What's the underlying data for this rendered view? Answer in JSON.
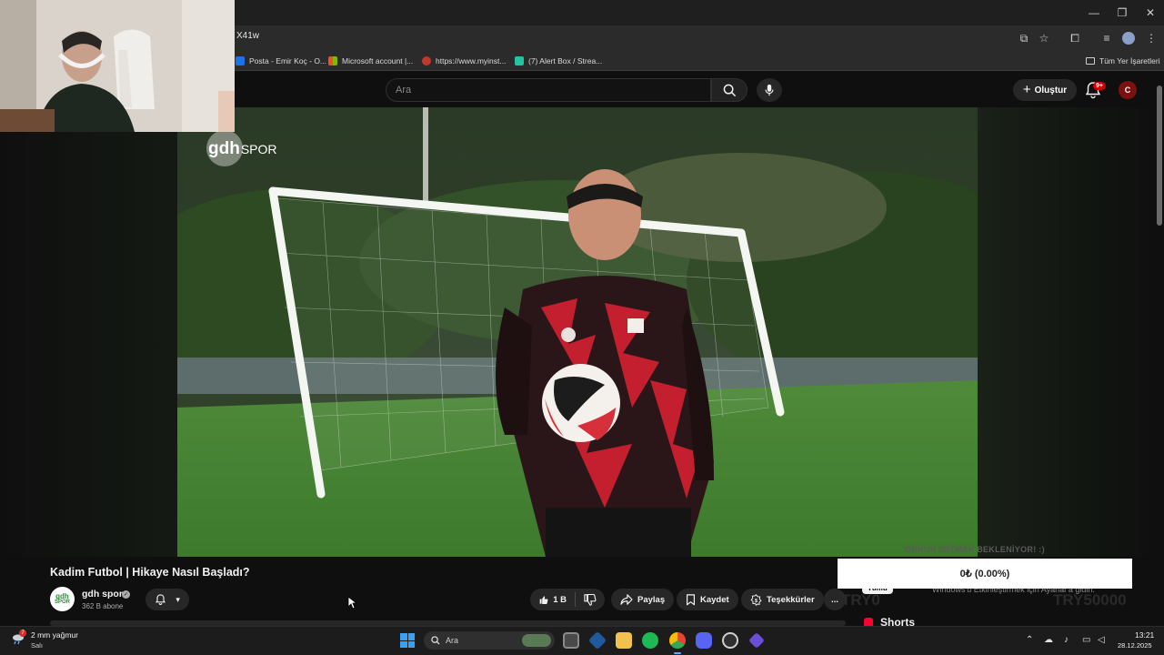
{
  "browser": {
    "url": "X41w",
    "bookmarks": [
      {
        "label": "Posta - Emir Koç - O...",
        "color": "#1a73e8"
      },
      {
        "label": "Microsoft account |...",
        "color": "#f25022"
      },
      {
        "label": "https://www.myinst...",
        "color": "#c0392b"
      },
      {
        "label": "(7) Alert Box / Strea...",
        "color": "#23c4a0"
      }
    ],
    "all_bookmarks": "Tüm Yer İşaretleri"
  },
  "youtube": {
    "search_placeholder": "Ara",
    "create_label": "Oluştur",
    "notifications_count": "9+",
    "avatar_letter": "C",
    "video_logo": "gdh",
    "video_logo_suffix": "SPOR"
  },
  "video_info": {
    "title": "Kadim Futbol | Hikaye Nasıl Başladı?",
    "channel": "gdh spor",
    "channel_avatar_line1": "gdh",
    "channel_avatar_line2": "SPOR",
    "subscribers": "362 B abone",
    "likes": "1 B",
    "share": "Paylaş",
    "save": "Kaydet",
    "thanks": "Teşekkürler",
    "more": "..."
  },
  "donation": {
    "goal_ghost": "ORKUN ISITMAK BEKLENİYOR! :)",
    "amount": "0₺ (0.00%)",
    "min": "TRY0",
    "max": "TRY50000"
  },
  "recommendations": {
    "chip_all": "Tümü",
    "activate_note": "Windows'u Etkinleştirmek için Ayarlar'a gidin.",
    "shorts_label": "Shorts"
  },
  "taskbar": {
    "weather_temp": "2 mm yağmur",
    "weather_day": "Salı",
    "weather_badge": "7",
    "search_placeholder": "Ara",
    "time": "13:21",
    "date": "28.12.2025"
  }
}
